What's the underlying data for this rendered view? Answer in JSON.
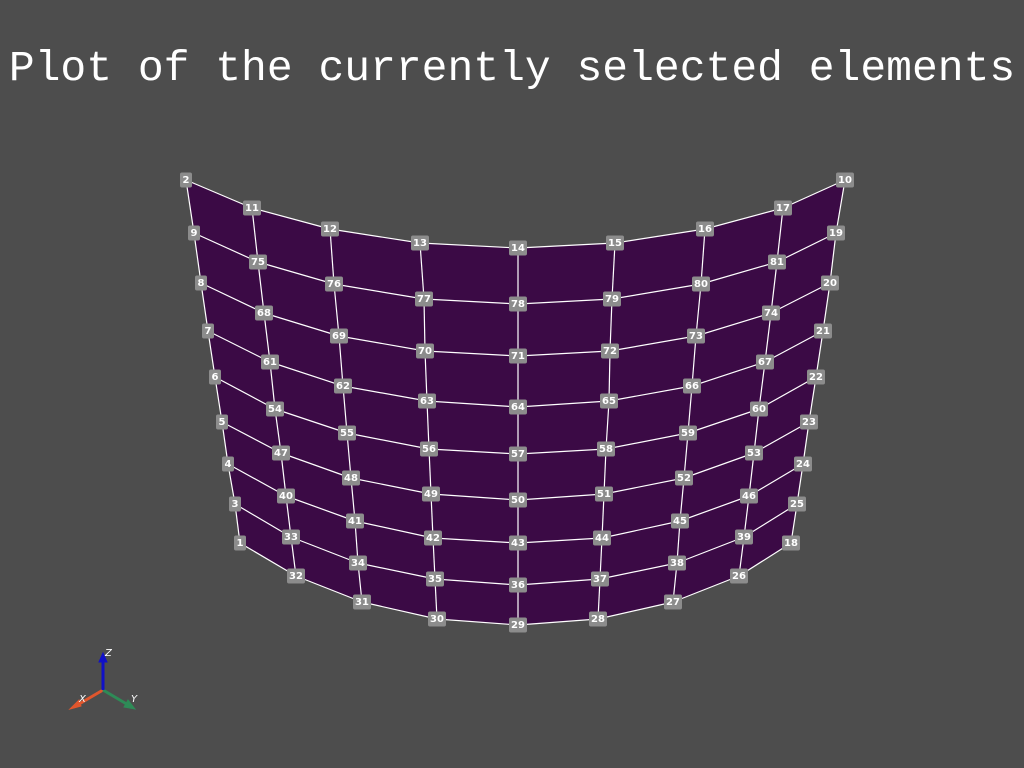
{
  "title": "Plot of the currently selected elements",
  "colors": {
    "background": "#4d4d4d",
    "mesh_fill": "#3b0a45",
    "mesh_edge": "#ffffff",
    "label_bg": "#8c8c8c",
    "label_text": "#ffffff",
    "axis_x": "#e0562d",
    "axis_y": "#2e8b57",
    "axis_z": "#1010c8"
  },
  "axes_widget": {
    "x_label": "X",
    "y_label": "Y",
    "z_label": "Z"
  },
  "node_labels": [
    "1",
    "2",
    "3",
    "4",
    "5",
    "6",
    "7",
    "8",
    "9",
    "10",
    "11",
    "12",
    "13",
    "14",
    "15",
    "16",
    "17",
    "18",
    "19",
    "20",
    "21",
    "22",
    "23",
    "24",
    "25",
    "26",
    "27",
    "28",
    "29",
    "30",
    "31",
    "32",
    "33",
    "34",
    "35",
    "36",
    "37",
    "38",
    "39",
    "40",
    "41",
    "42",
    "43",
    "44",
    "45",
    "46",
    "47",
    "48",
    "49",
    "50",
    "51",
    "52",
    "53",
    "54",
    "55",
    "56",
    "57",
    "58",
    "59",
    "60",
    "61",
    "62",
    "63",
    "64",
    "65",
    "66",
    "67",
    "68",
    "69",
    "70",
    "71",
    "72",
    "73",
    "74",
    "75",
    "76",
    "77",
    "78",
    "79",
    "80",
    "81"
  ]
}
